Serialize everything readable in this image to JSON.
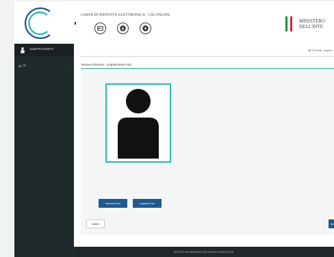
{
  "header": {
    "app_title": "CARTA DI IDENTITÀ ELETTRONICA - CIE ONLINE",
    "ministry_line1": "MINISTERO",
    "ministry_line2": "DELL'INTE",
    "icons": [
      "id-card-icon",
      "download-icon",
      "settings-icon"
    ]
  },
  "sidebar": {
    "user_name": "GIUSEPPE ROSSETTI",
    "items": [
      {
        "label": "CIE"
      }
    ]
  },
  "breadcrumb": {
    "items": [
      "CIE Online",
      "Acquisiz..."
    ]
  },
  "main": {
    "page_title": "Nuova richiesta - Acquisizione Foto",
    "select_photo_label": "Seleziona Foto",
    "acquire_photo_label": "Acquisisci Foto",
    "back_label": "Indietro",
    "next_label": "Avanti"
  },
  "footer": {
    "text": "ISTITUTO POLIGRAFICO E ZECCA DELLO STATO S.P.A."
  },
  "colors": {
    "sidebar_bg": "#202a2c",
    "accent_teal": "#2ab3ae",
    "button_blue": "#1e5a8d",
    "flag_green": "#009246",
    "flag_red": "#ce2b37"
  }
}
